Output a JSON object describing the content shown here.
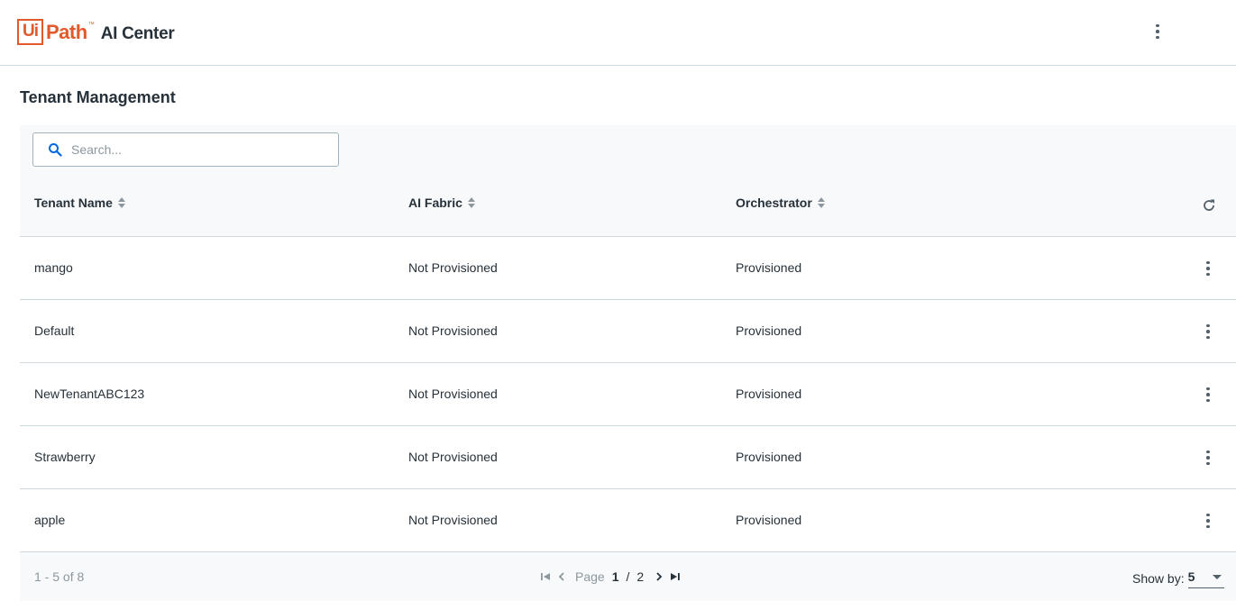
{
  "header": {
    "logo_ui": "Ui",
    "logo_path": "Path",
    "logo_tm": "™",
    "app_name": "AI Center",
    "menu_icon": "more-vertical-icon"
  },
  "page": {
    "title": "Tenant Management"
  },
  "search": {
    "placeholder": "Search...",
    "value": "",
    "icon": "search-icon"
  },
  "table": {
    "columns": [
      {
        "label": "Tenant Name",
        "sortable": true
      },
      {
        "label": "AI Fabric",
        "sortable": true
      },
      {
        "label": "Orchestrator",
        "sortable": true
      }
    ],
    "refresh_icon": "refresh-icon",
    "rows": [
      {
        "tenant": "mango",
        "ai_fabric": "Not Provisioned",
        "orchestrator": "Provisioned"
      },
      {
        "tenant": "Default",
        "ai_fabric": "Not Provisioned",
        "orchestrator": "Provisioned"
      },
      {
        "tenant": "NewTenantABC123",
        "ai_fabric": "Not Provisioned",
        "orchestrator": "Provisioned"
      },
      {
        "tenant": "Strawberry",
        "ai_fabric": "Not Provisioned",
        "orchestrator": "Provisioned"
      },
      {
        "tenant": "apple",
        "ai_fabric": "Not Provisioned",
        "orchestrator": "Provisioned"
      }
    ]
  },
  "footer": {
    "range": "1 - 5 of 8",
    "page_word": "Page",
    "current_page": "1",
    "separator": "/",
    "total_pages": "2",
    "show_by_label": "Show by:",
    "show_by_value": "5"
  },
  "colors": {
    "brand": "#e2592b",
    "accent": "#0067df",
    "text": "#273139",
    "muted": "#8c979e"
  }
}
